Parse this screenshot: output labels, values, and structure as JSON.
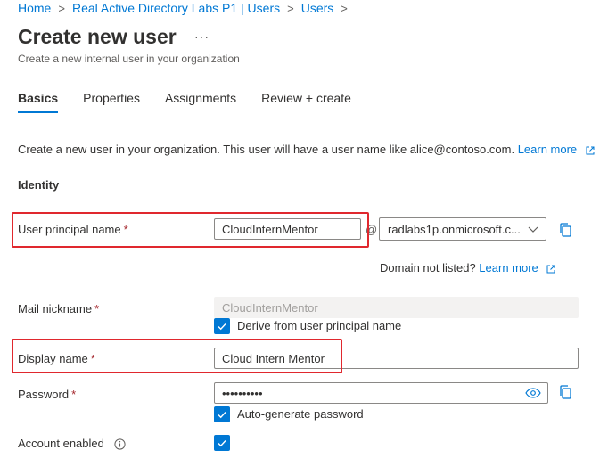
{
  "breadcrumb": {
    "items": [
      "Home",
      "Real Active Directory Labs P1 | Users",
      "Users"
    ],
    "separator": ">"
  },
  "header": {
    "title": "Create new user",
    "more_label": "···",
    "subtitle": "Create a new internal user in your organization"
  },
  "tabs": [
    {
      "label": "Basics",
      "active": true
    },
    {
      "label": "Properties",
      "active": false
    },
    {
      "label": "Assignments",
      "active": false
    },
    {
      "label": "Review + create",
      "active": false
    }
  ],
  "intro": {
    "text": "Create a new user in your organization. This user will have a user name like alice@contoso.com.",
    "link": "Learn more"
  },
  "identity": {
    "heading": "Identity",
    "upn": {
      "label": "User principal name",
      "required": "*",
      "value": "CloudInternMentor",
      "at": "@",
      "domain": "radlabs1p.onmicrosoft.c..."
    },
    "domain_hint": {
      "text": "Domain not listed?",
      "link": "Learn more"
    },
    "mail_nickname": {
      "label": "Mail nickname",
      "required": "*",
      "value": "CloudInternMentor",
      "derive_label": "Derive from user principal name",
      "derive_checked": true
    },
    "display_name": {
      "label": "Display name",
      "required": "*",
      "value": "Cloud Intern Mentor"
    },
    "password": {
      "label": "Password",
      "required": "*",
      "value": "••••••••••",
      "auto_label": "Auto-generate password",
      "auto_checked": true
    },
    "account_enabled": {
      "label": "Account enabled",
      "checked": true
    }
  },
  "colors": {
    "accent": "#0078d4",
    "highlight": "#e0282e",
    "required": "#a4262c"
  }
}
